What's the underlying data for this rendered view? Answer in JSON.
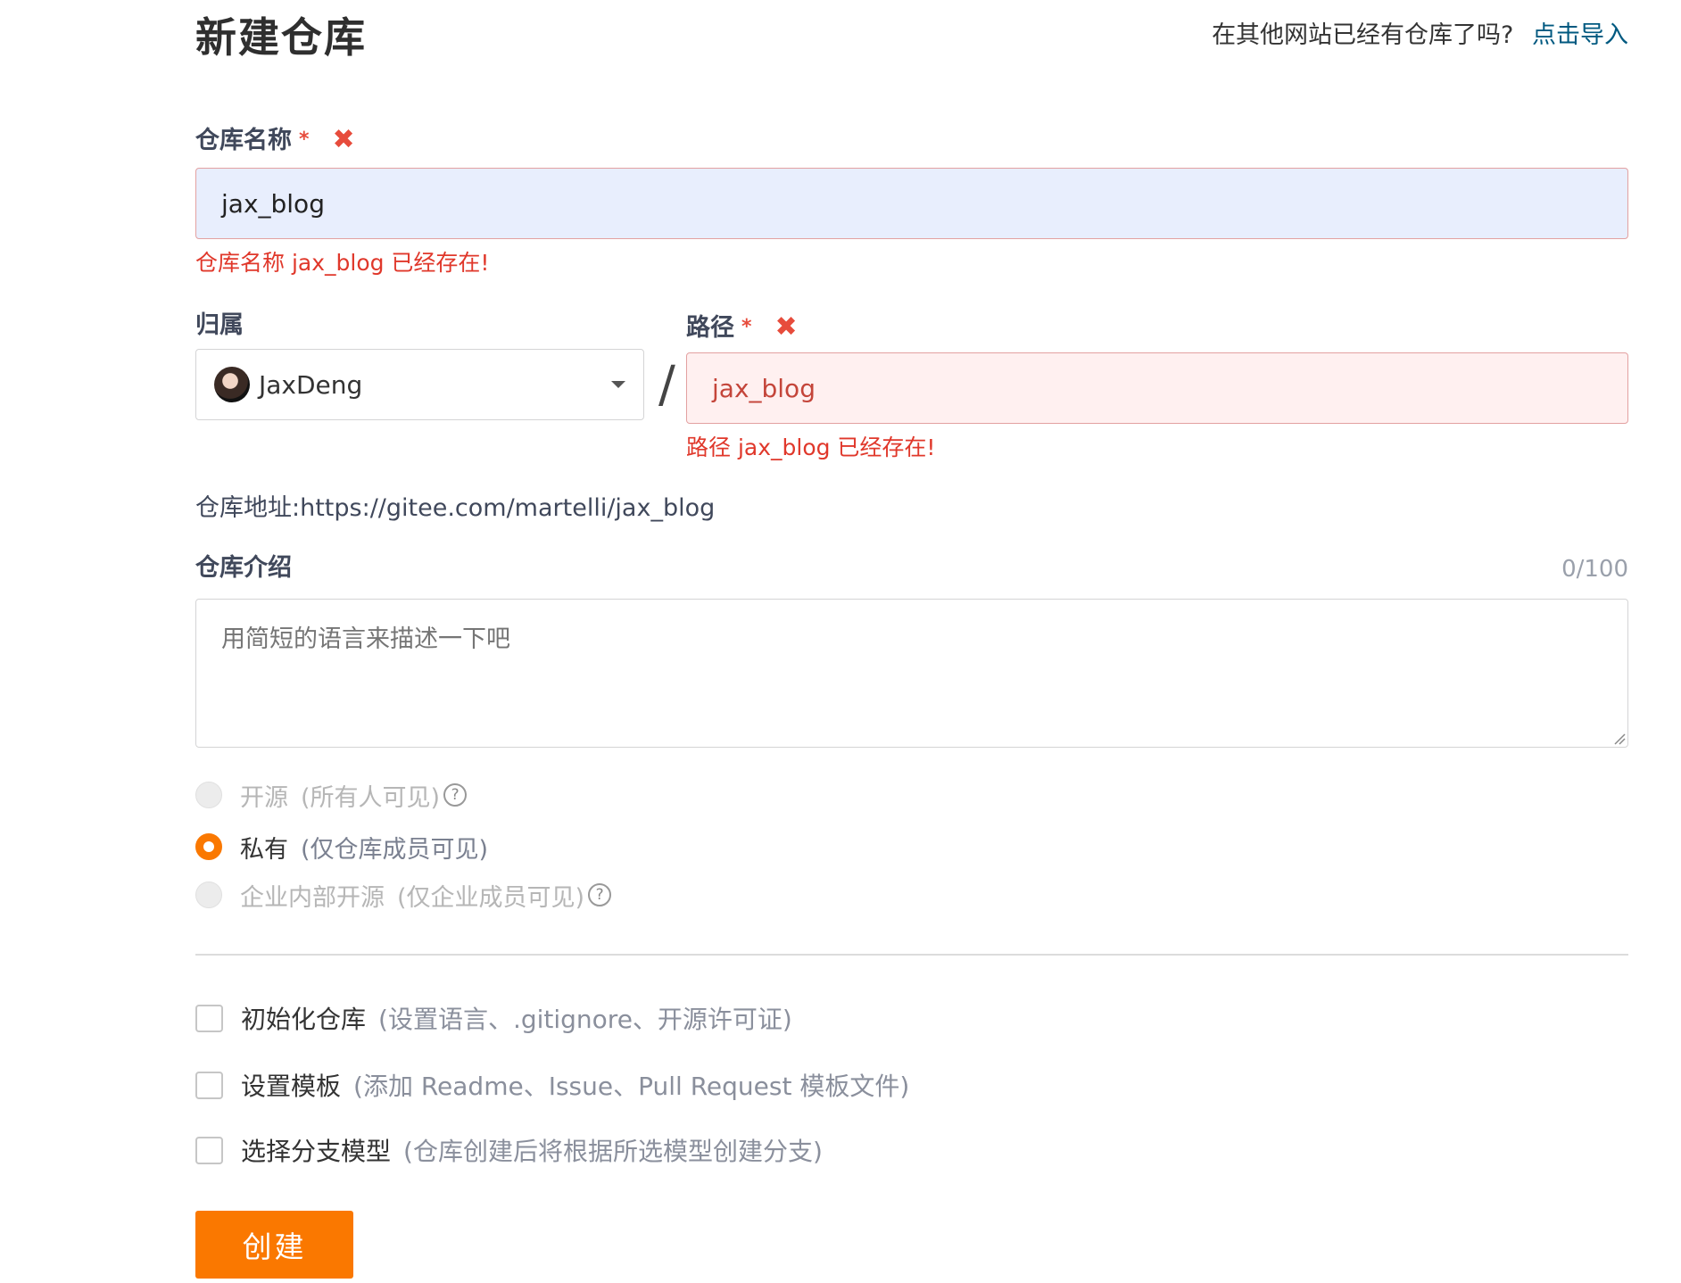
{
  "page": {
    "title": "新建仓库",
    "import_question": "在其他网站已经有仓库了吗?",
    "import_link": "点击导入"
  },
  "repo_name": {
    "label": "仓库名称",
    "required_mark": "*",
    "error_mark": "✖",
    "value": "jax_blog",
    "error": "仓库名称 jax_blog 已经存在!"
  },
  "owner": {
    "label": "归属",
    "value": "JaxDeng"
  },
  "separator": "/",
  "path": {
    "label": "路径",
    "required_mark": "*",
    "error_mark": "✖",
    "value": "jax_blog",
    "error": "路径 jax_blog 已经存在!"
  },
  "address": {
    "label": "仓库地址:",
    "value": "https://gitee.com/martelli/jax_blog"
  },
  "description": {
    "label": "仓库介绍",
    "counter": "0/100",
    "placeholder": "用简短的语言来描述一下吧"
  },
  "visibility": {
    "options": [
      {
        "label": "开源",
        "hint": "(所有人可见)",
        "help": "?",
        "selected": false,
        "disabled": true
      },
      {
        "label": "私有",
        "hint": "(仅仓库成员可见)",
        "selected": true,
        "disabled": false
      },
      {
        "label": "企业内部开源",
        "hint": "(仅企业成员可见)",
        "help": "?",
        "selected": false,
        "disabled": true
      }
    ]
  },
  "options": [
    {
      "label": "初始化仓库",
      "hint": "(设置语言、.gitignore、开源许可证)",
      "checked": false
    },
    {
      "label": "设置模板",
      "hint": "(添加 Readme、Issue、Pull Request 模板文件)",
      "checked": false
    },
    {
      "label": "选择分支模型",
      "hint": "(仓库创建后将根据所选模型创建分支)",
      "checked": false
    }
  ],
  "submit": {
    "label": "创建"
  },
  "colors": {
    "accent": "#fa7800",
    "error": "#e0382b",
    "link": "#005980"
  }
}
